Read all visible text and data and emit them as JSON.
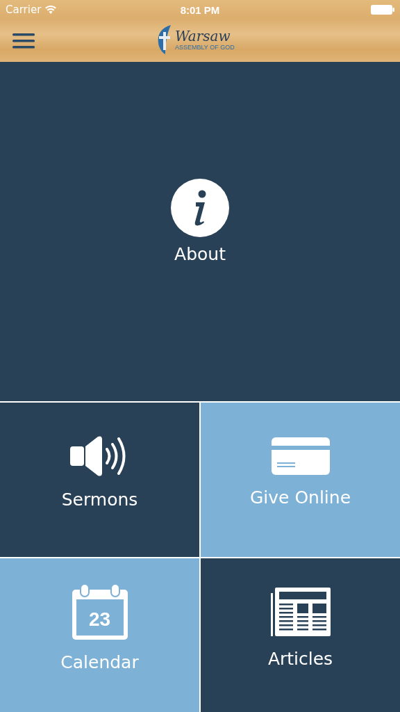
{
  "status_bar": {
    "carrier": "Carrier",
    "time": "8:01 PM"
  },
  "header": {
    "logo": {
      "name": "Warsaw",
      "subtitle": "ASSEMBLY OF GOD"
    }
  },
  "hero": {
    "label": "About",
    "kind": "info",
    "color": "#284157"
  },
  "tiles": [
    {
      "label": "Sermons",
      "kind": "speaker",
      "color": "#284157"
    },
    {
      "label": "Give Online",
      "kind": "card",
      "color": "#7db1d6"
    },
    {
      "label": "Calendar",
      "kind": "calendar",
      "color": "#7db1d6",
      "day": "23"
    },
    {
      "label": "Articles",
      "kind": "newspaper",
      "color": "#284157"
    }
  ]
}
